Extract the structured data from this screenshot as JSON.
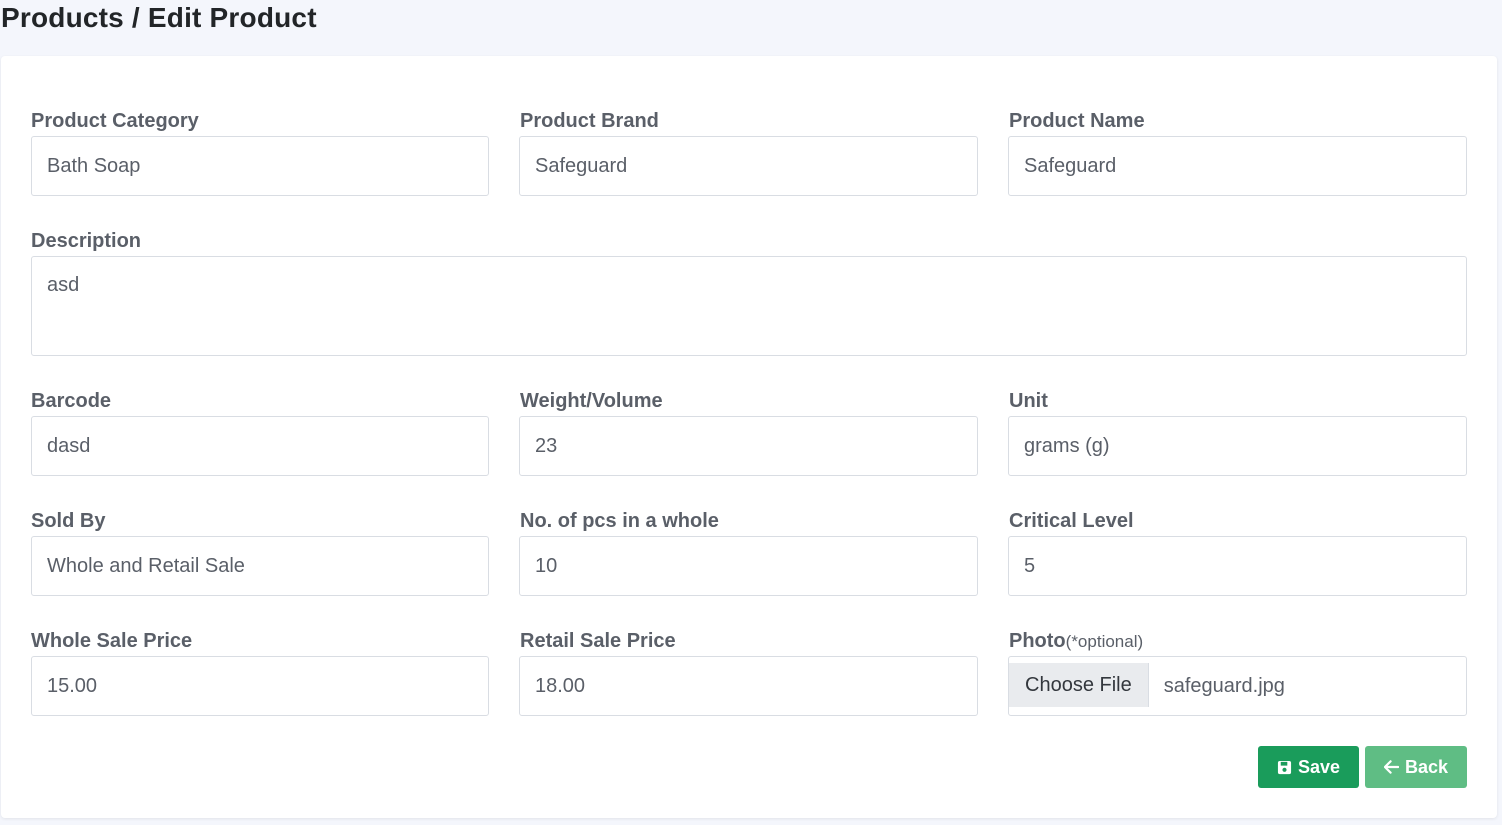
{
  "header": {
    "title": "Products / Edit Product"
  },
  "form": {
    "category": {
      "label": "Product Category",
      "value": "Bath Soap"
    },
    "brand": {
      "label": "Product Brand",
      "value": "Safeguard"
    },
    "name": {
      "label": "Product Name",
      "value": "Safeguard"
    },
    "description": {
      "label": "Description",
      "value": "asd"
    },
    "barcode": {
      "label": "Barcode",
      "value": "dasd"
    },
    "weight": {
      "label": "Weight/Volume",
      "value": "23"
    },
    "unit": {
      "label": "Unit",
      "value": "grams (g)"
    },
    "sold_by": {
      "label": "Sold By",
      "value": "Whole and Retail Sale"
    },
    "pcs_whole": {
      "label": "No. of pcs in a whole",
      "value": "10"
    },
    "critical": {
      "label": "Critical Level",
      "value": "5"
    },
    "whole_price": {
      "label": "Whole Sale Price",
      "value": "15.00"
    },
    "retail_price": {
      "label": "Retail Sale Price",
      "value": "18.00"
    },
    "photo": {
      "label": "Photo",
      "optional": "(*optional)",
      "button_label": "Choose File",
      "file_name": "safeguard.jpg"
    }
  },
  "actions": {
    "save_label": "Save",
    "save_icon": "floppy-disk-icon",
    "back_label": "Back",
    "back_icon": "arrow-left-icon"
  },
  "colors": {
    "save": "#1a9c5b",
    "back": "#5fbd84",
    "page_bg": "#f4f6fc"
  }
}
